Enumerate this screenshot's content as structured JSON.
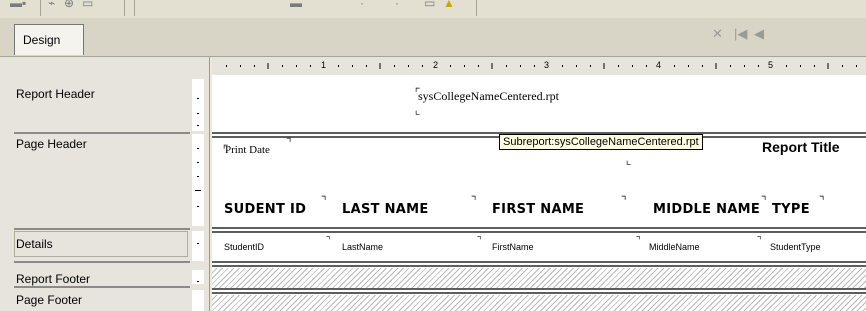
{
  "toolbar": {},
  "tabs": {
    "design": "Design"
  },
  "nav": {
    "close": "✕",
    "first": "|◀",
    "prev": "◀"
  },
  "ruler": {
    "marks": [
      "1",
      "2",
      "3",
      "4",
      "5"
    ]
  },
  "sections": {
    "report_header": "Report Header",
    "page_header": "Page Header",
    "details": "Details",
    "report_footer": "Report Footer",
    "page_footer": "Page Footer"
  },
  "report_header": {
    "subreport_name": "sysCollegeNameCentered.rpt"
  },
  "page_header": {
    "print_date": "Print Date",
    "tooltip": "Subreport:sysCollegeNameCentered.rpt",
    "report_title": "Report Title",
    "columns": [
      "SUDENT ID",
      "LAST NAME",
      "FIRST NAME",
      "MIDDLE NAME",
      "TYPE"
    ]
  },
  "details": {
    "fields": [
      "StudentID",
      "LastName",
      "FirstName",
      "MiddleName",
      "StudentType"
    ]
  }
}
